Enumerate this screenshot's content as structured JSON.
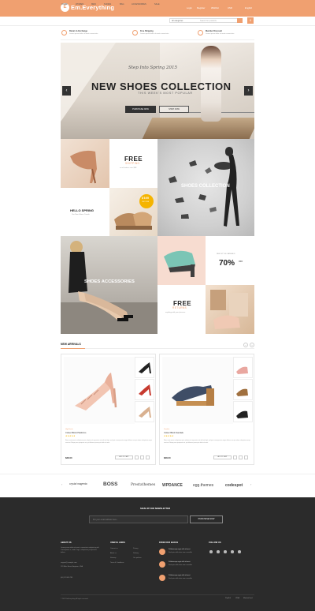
{
  "header": {
    "logo_text": "Em.Everything",
    "links": [
      "Login",
      "Register",
      "Wishlist",
      "USD",
      "English"
    ],
    "nav": [
      "Home",
      "Women",
      "Men",
      "Shoes",
      "Bag",
      "Accessories",
      "Sale"
    ],
    "search": {
      "category": "All categories",
      "placeholder": "Search for products"
    },
    "cart_count": "0"
  },
  "features": [
    {
      "title": "Return & Exchange",
      "sub": "Lorem ipsum dolor sit amet consectetur"
    },
    {
      "title": "Free Shipping",
      "sub": "Lorem ipsum dolor sit amet consectetur"
    },
    {
      "title": "Member Discount",
      "sub": "Lorem ipsum dolor sit amet consectetur"
    }
  ],
  "hero": {
    "kicker": "Step Into Spring 2015",
    "title": "NEW SHOES COLLECTION",
    "subtitle": "THIS WEEK'S MOST POPULAR",
    "btn_primary": "PURCHASE NOW",
    "btn_secondary": "SHOP NOW",
    "prev": "‹",
    "next": "›"
  },
  "promos": {
    "free_shipping_title": "FREE",
    "free_shipping_sub": "SHIPPING",
    "free_shipping_note": "on all orders over $99",
    "shoes_collection": "SHOES COLLECTION",
    "spring_title": "HELLO SPRING",
    "spring_note": "Our New Shoes Trends",
    "price_badge": "$ 9.99",
    "price_badge_note": "ONLY ONE",
    "accessories": "SHOES ACCESSORIES",
    "sale_note": "NEW STYLE SANDALS",
    "sale_big": "70%",
    "sale_off": "OFF",
    "free_returns_title": "FREE",
    "free_returns_sub": "RETURNS",
    "free_returns_note": "anything with your pleasure"
  },
  "new_arrivals": {
    "title": "NEW ARRIVALS",
    "prev": "‹",
    "next": "›",
    "products": [
      {
        "brand": "High Heels",
        "name": "Colour Block Platforms",
        "stars": "★★★★★",
        "desc": "Nemo enim ipsam voluptatem quia voluptas sit aspernatur aut odit aut fugit, sed quia consequuntur magni dolores eos qui ratione voluptatem sequi nesciunt. Neque porro quisquam est, qui dolorem ipsum quia dolor sit amet.",
        "price": "$38.00",
        "add": "ADD TO CART"
      },
      {
        "brand": "Sandals",
        "name": "Colour Block Sandals",
        "stars": "★★★★★",
        "desc": "Nemo enim ipsam voluptatem quia voluptas sit aspernatur aut odit aut fugit, sed quia consequuntur magni dolores eos qui ratione voluptatem sequi nesciunt. Neque porro quisquam est, qui dolorem ipsum quia dolor sit amet.",
        "price": "$38.00",
        "add": "ADD TO CART"
      }
    ]
  },
  "brands": [
    "crystal magenta",
    "BOSS",
    "Prestathemes",
    "WPDANCE",
    "egg.themes",
    "codespot"
  ],
  "newsletter": {
    "title": "SIGN UP FOR NEWSLETTER",
    "placeholder": "Put your email address here...",
    "button": "PURCHASE NOW"
  },
  "footer": {
    "about_title": "ABOUT US",
    "about_text": "Lorem ipsum dolor sit amet, consectetur adipisicing elit. Consequatur a, modi. Fuga, voluptatem perspiciatis dolore.",
    "email": "support@example.com",
    "address": "123 Main Street, Anytown, USA",
    "phone": "(00) 123 456 789",
    "links_title": "USEFUL LINKS",
    "links_col1": [
      "Contact us",
      "About us",
      "Sitemap",
      "Terms & Conditions"
    ],
    "links_col2": [
      "Privacy",
      "Delivery",
      "Our policies"
    ],
    "blog_title": "FROM OUR BLOGS",
    "blog_posts": [
      {
        "title": "Pellentesque eget nibh id amet",
        "text": "Sed quis nulla vitae sem convallis"
      },
      {
        "title": "Pellentesque eget nibh id amet",
        "text": "Sed quis nulla vitae sem convallis"
      },
      {
        "title": "Pellentesque eget nibh id amet",
        "text": "Sed quis nulla vitae sem convallis"
      }
    ],
    "follow_title": "FOLLOW US",
    "copyright": "© 2015 EmEverything. All rights reserved.",
    "payments": [
      "PayPal",
      "VISA",
      "MasterCard"
    ]
  },
  "colors": {
    "accent": "#f0a070",
    "dark": "#2b2b2b"
  }
}
